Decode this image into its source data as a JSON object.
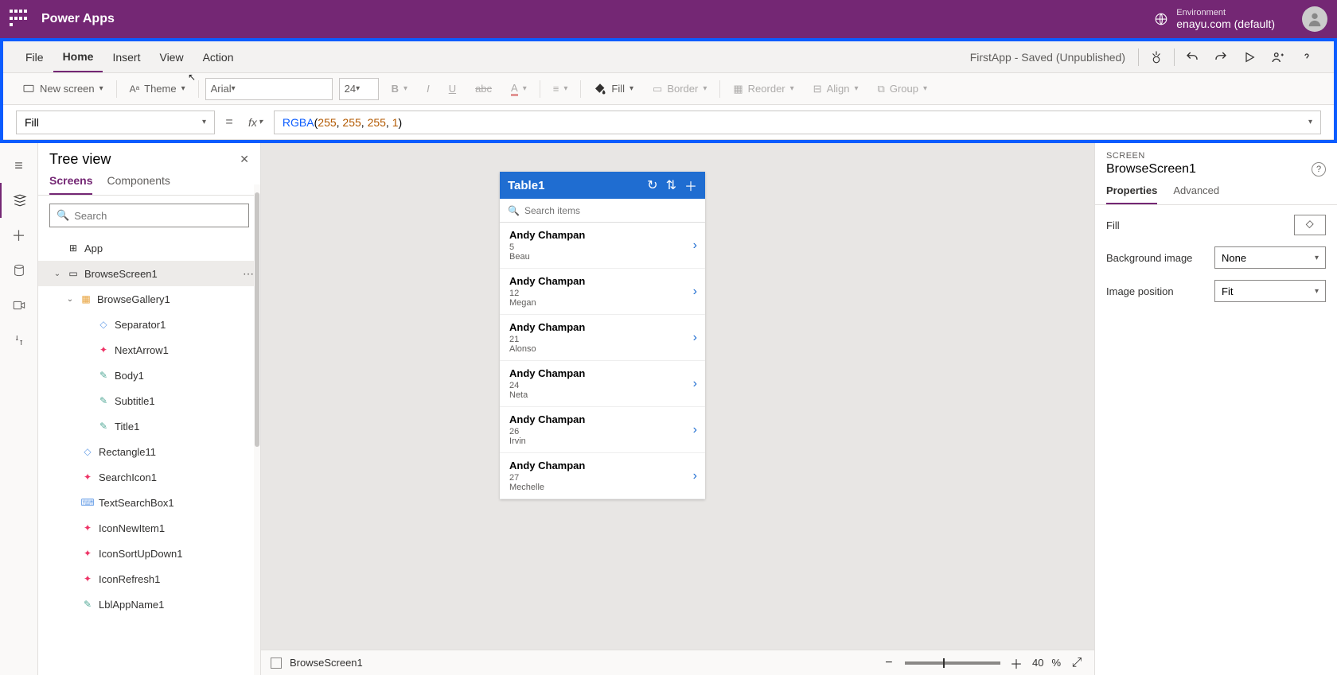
{
  "header": {
    "brand": "Power Apps",
    "env_label": "Environment",
    "env_name": "enayu.com (default)"
  },
  "menu": {
    "items": [
      "File",
      "Home",
      "Insert",
      "View",
      "Action"
    ],
    "active": "Home",
    "status": "FirstApp - Saved (Unpublished)"
  },
  "toolbar": {
    "new_screen": "New screen",
    "theme": "Theme",
    "font": "Arial",
    "font_size": "24",
    "fill_label": "Fill",
    "border_label": "Border",
    "reorder_label": "Reorder",
    "align_label": "Align",
    "group_label": "Group"
  },
  "formula": {
    "property": "Fill",
    "fn": "RGBA",
    "args": [
      "255",
      "255",
      "255",
      "1"
    ]
  },
  "tree": {
    "title": "Tree view",
    "tabs": [
      "Screens",
      "Components"
    ],
    "active_tab": "Screens",
    "search_placeholder": "Search",
    "nodes": {
      "app": "App",
      "browsescreen": "BrowseScreen1",
      "gallery": "BrowseGallery1",
      "children": [
        "Separator1",
        "NextArrow1",
        "Body1",
        "Subtitle1",
        "Title1"
      ],
      "siblings": [
        "Rectangle11",
        "SearchIcon1",
        "TextSearchBox1",
        "IconNewItem1",
        "IconSortUpDown1",
        "IconRefresh1",
        "LblAppName1"
      ]
    }
  },
  "phone": {
    "header_title": "Table1",
    "search_placeholder": "Search items",
    "items": [
      {
        "title": "Andy Champan",
        "num": "5",
        "sub": "Beau"
      },
      {
        "title": "Andy Champan",
        "num": "12",
        "sub": "Megan"
      },
      {
        "title": "Andy Champan",
        "num": "21",
        "sub": "Alonso"
      },
      {
        "title": "Andy Champan",
        "num": "24",
        "sub": "Neta"
      },
      {
        "title": "Andy Champan",
        "num": "26",
        "sub": "Irvin"
      },
      {
        "title": "Andy Champan",
        "num": "27",
        "sub": "Mechelle"
      }
    ]
  },
  "status": {
    "screen_name": "BrowseScreen1",
    "zoom": "40",
    "zoom_suffix": "%"
  },
  "props": {
    "category": "SCREEN",
    "name": "BrowseScreen1",
    "tabs": [
      "Properties",
      "Advanced"
    ],
    "active_tab": "Properties",
    "fill_label": "Fill",
    "bg_label": "Background image",
    "bg_value": "None",
    "pos_label": "Image position",
    "pos_value": "Fit"
  }
}
